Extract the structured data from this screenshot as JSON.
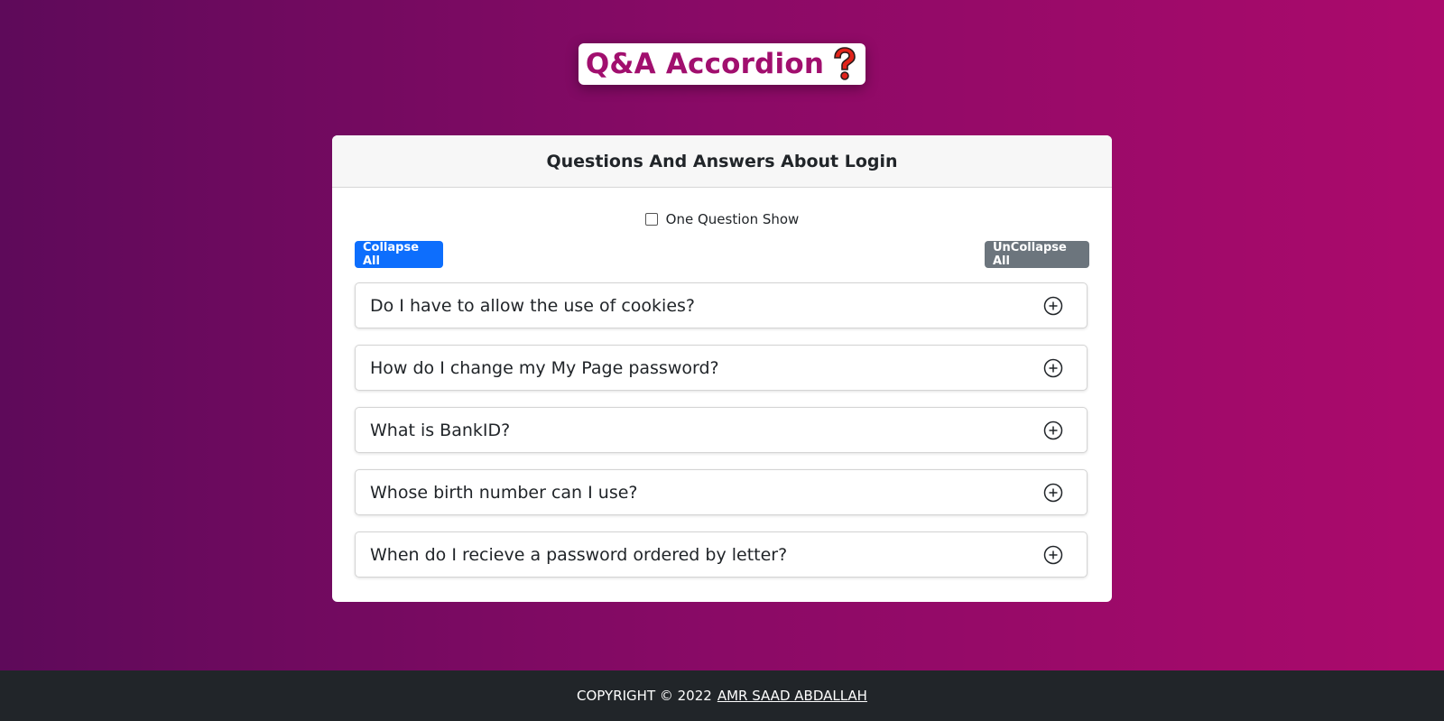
{
  "header": {
    "title": "Q&A Accordion",
    "title_icon": "question-mark-icon"
  },
  "card": {
    "title": "Questions And Answers About Login",
    "checkbox_label": "One Question Show",
    "collapse_label": "Collapse All",
    "uncollapse_label": "UnCollapse All"
  },
  "questions": [
    "Do I have to allow the use of cookies?",
    "How do I change my My Page password?",
    "What is BankID?",
    "Whose birth number can I use?",
    "When do I recieve a password ordered by letter?"
  ],
  "footer": {
    "copyright": "COPYRIGHT © 2022",
    "author": "AMR SAAD ABDALLAH"
  },
  "colors": {
    "accent": "#a10f6e",
    "primary_button": "#0d6efd",
    "secondary_button": "#6c757d",
    "footer_bg": "#212529"
  }
}
